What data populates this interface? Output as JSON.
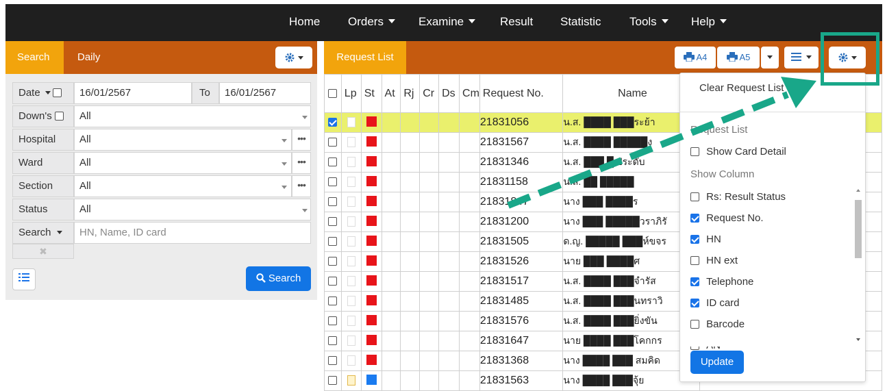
{
  "nav": {
    "home": "Home",
    "orders": "Orders",
    "examine": "Examine",
    "result": "Result",
    "statistic": "Statistic",
    "tools": "Tools",
    "help": "Help"
  },
  "left_panel": {
    "tab_search": "Search",
    "tab_daily": "Daily",
    "date_label": "Date",
    "date_from": "16/01/2567",
    "to_label": "To",
    "date_to": "16/01/2567",
    "downs_label": "Down's",
    "downs_value": "All",
    "hospital_label": "Hospital",
    "hospital_value": "All",
    "ward_label": "Ward",
    "ward_value": "All",
    "section_label": "Section",
    "section_value": "All",
    "status_label": "Status",
    "status_value": "All",
    "search_label": "Search",
    "search_placeholder": "HN, Name, ID card",
    "search_button": "Search"
  },
  "right_panel": {
    "tab_request_list": "Request List",
    "print_a4": "A4",
    "print_a5": "A5"
  },
  "table": {
    "headers": [
      "Lp",
      "St",
      "At",
      "Rj",
      "Cr",
      "Ds",
      "Cm",
      "Request No.",
      "Name"
    ],
    "rows": [
      {
        "checked": true,
        "req": "21831056",
        "name": "น.ส. ████ ███ระย้า",
        "status": "red",
        "lp": "plain"
      },
      {
        "checked": false,
        "req": "21831567",
        "name": "น.ส. ████ █████ง",
        "status": "red",
        "lp": "plain"
      },
      {
        "checked": false,
        "req": "21831346",
        "name": "น.ส. ███ █ ประดับ",
        "status": "red",
        "lp": "plain"
      },
      {
        "checked": false,
        "req": "21831158",
        "name": "น.ส. ██ █████",
        "status": "red",
        "lp": "plain"
      },
      {
        "checked": false,
        "req": "21831847",
        "name": "นาง ███ ████ร",
        "status": "red",
        "lp": "plain"
      },
      {
        "checked": false,
        "req": "21831200",
        "name": "นาง ███ █████วราภิรั",
        "status": "red",
        "lp": "plain"
      },
      {
        "checked": false,
        "req": "21831505",
        "name": "ด.ญ. █████ ███ห์ขจร",
        "status": "red",
        "lp": "plain"
      },
      {
        "checked": false,
        "req": "21831526",
        "name": "นาย ███ ████ศ",
        "status": "red",
        "lp": "plain"
      },
      {
        "checked": false,
        "req": "21831517",
        "name": "น.ส. ████ ███จำรัส",
        "status": "red",
        "lp": "plain"
      },
      {
        "checked": false,
        "req": "21831485",
        "name": "น.ส. ████ ███นทราวิ",
        "status": "red",
        "lp": "plain"
      },
      {
        "checked": false,
        "req": "21831576",
        "name": "น.ส. ████ ███ยิ่งขัน",
        "status": "red",
        "lp": "plain"
      },
      {
        "checked": false,
        "req": "21831647",
        "name": "นาย ████ ███โคกกร",
        "status": "red",
        "lp": "plain"
      },
      {
        "checked": false,
        "req": "21831368",
        "name": "นาง ████ ███ สมคิด",
        "status": "red",
        "lp": "plain"
      },
      {
        "checked": false,
        "req": "21831563",
        "name": "นาง ████ ███จุ้ย",
        "status": "blue",
        "lp": "yellow"
      }
    ]
  },
  "dropdown": {
    "clear": "Clear Request List",
    "section_request_list": "Request List",
    "show_card_detail": "Show Card Detail",
    "section_show_column": "Show Column",
    "columns": [
      {
        "label": "Rs: Result Status",
        "checked": false
      },
      {
        "label": "Request No.",
        "checked": true
      },
      {
        "label": "HN",
        "checked": true
      },
      {
        "label": "HN ext",
        "checked": false
      },
      {
        "label": "Telephone",
        "checked": true
      },
      {
        "label": "ID card",
        "checked": true
      },
      {
        "label": "Barcode",
        "checked": false
      },
      {
        "label": "AN",
        "checked": false
      }
    ],
    "update": "Update"
  },
  "colors": {
    "nav_bg": "#1f1f1f",
    "header_orange": "#c55a0f",
    "tab_active": "#f2a40c",
    "primary_blue": "#1275e5",
    "annotation_green": "#19a789",
    "row_highlight": "#eaf06d",
    "status_red": "#e8141a",
    "status_blue": "#1a7bf0"
  }
}
